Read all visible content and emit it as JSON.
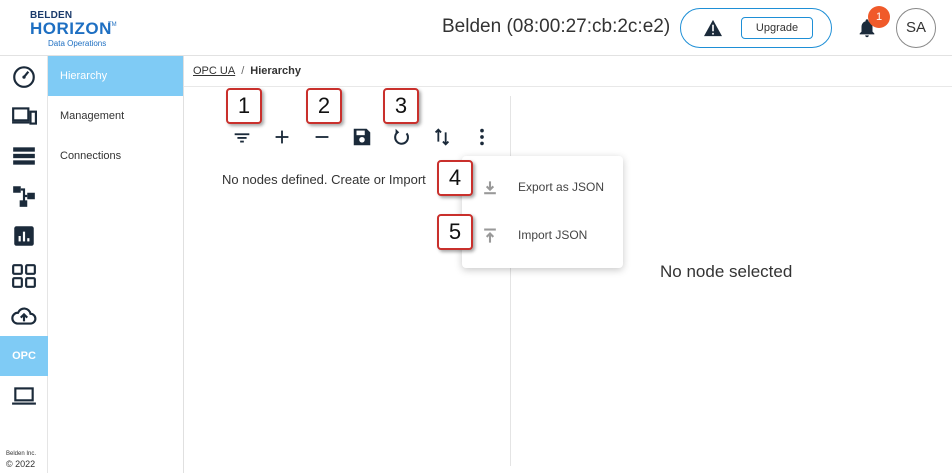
{
  "header": {
    "logo_top": "BELDEN",
    "logo_main": "HORIZON",
    "logo_tm": "TM",
    "logo_sub": "Data Operations",
    "device_title": "Belden (08:00:27:cb:2c:e2)",
    "upgrade_label": "Upgrade",
    "notification_count": "1",
    "avatar_initials": "SA"
  },
  "rail": {
    "items": [
      "dashboard-icon",
      "devices-icon",
      "list-icon",
      "topology-icon",
      "analytics-icon",
      "apps-icon",
      "cloud-upload-icon",
      "opc",
      "laptop-icon"
    ],
    "opc_label": "OPC",
    "footer_company": "Belden Inc.",
    "footer_copyright": "© 2022"
  },
  "subnav": {
    "items": [
      {
        "label": "Hierarchy",
        "active": true
      },
      {
        "label": "Management",
        "active": false
      },
      {
        "label": "Connections",
        "active": false
      }
    ]
  },
  "breadcrumb": {
    "root": "OPC UA",
    "separator": "/",
    "current": "Hierarchy"
  },
  "toolbar": {
    "tools": [
      "filter-icon",
      "add-icon",
      "remove-icon",
      "save-icon",
      "refresh-icon",
      "sort-icon",
      "more-vert-icon"
    ]
  },
  "tree": {
    "empty_message": "No nodes defined. Create or Import"
  },
  "detail": {
    "empty_message": "No node selected"
  },
  "menu": {
    "export_label": "Export as JSON",
    "import_label": "Import JSON"
  },
  "callouts": [
    "1",
    "2",
    "3",
    "4",
    "5"
  ],
  "colors": {
    "accent": "#7fcbf5",
    "brand_blue": "#1e6fc2",
    "pill_border": "#1e8fd6",
    "badge": "#f05a2a",
    "callout_border": "#c9302c",
    "icon_dark": "#1b2a3a"
  }
}
